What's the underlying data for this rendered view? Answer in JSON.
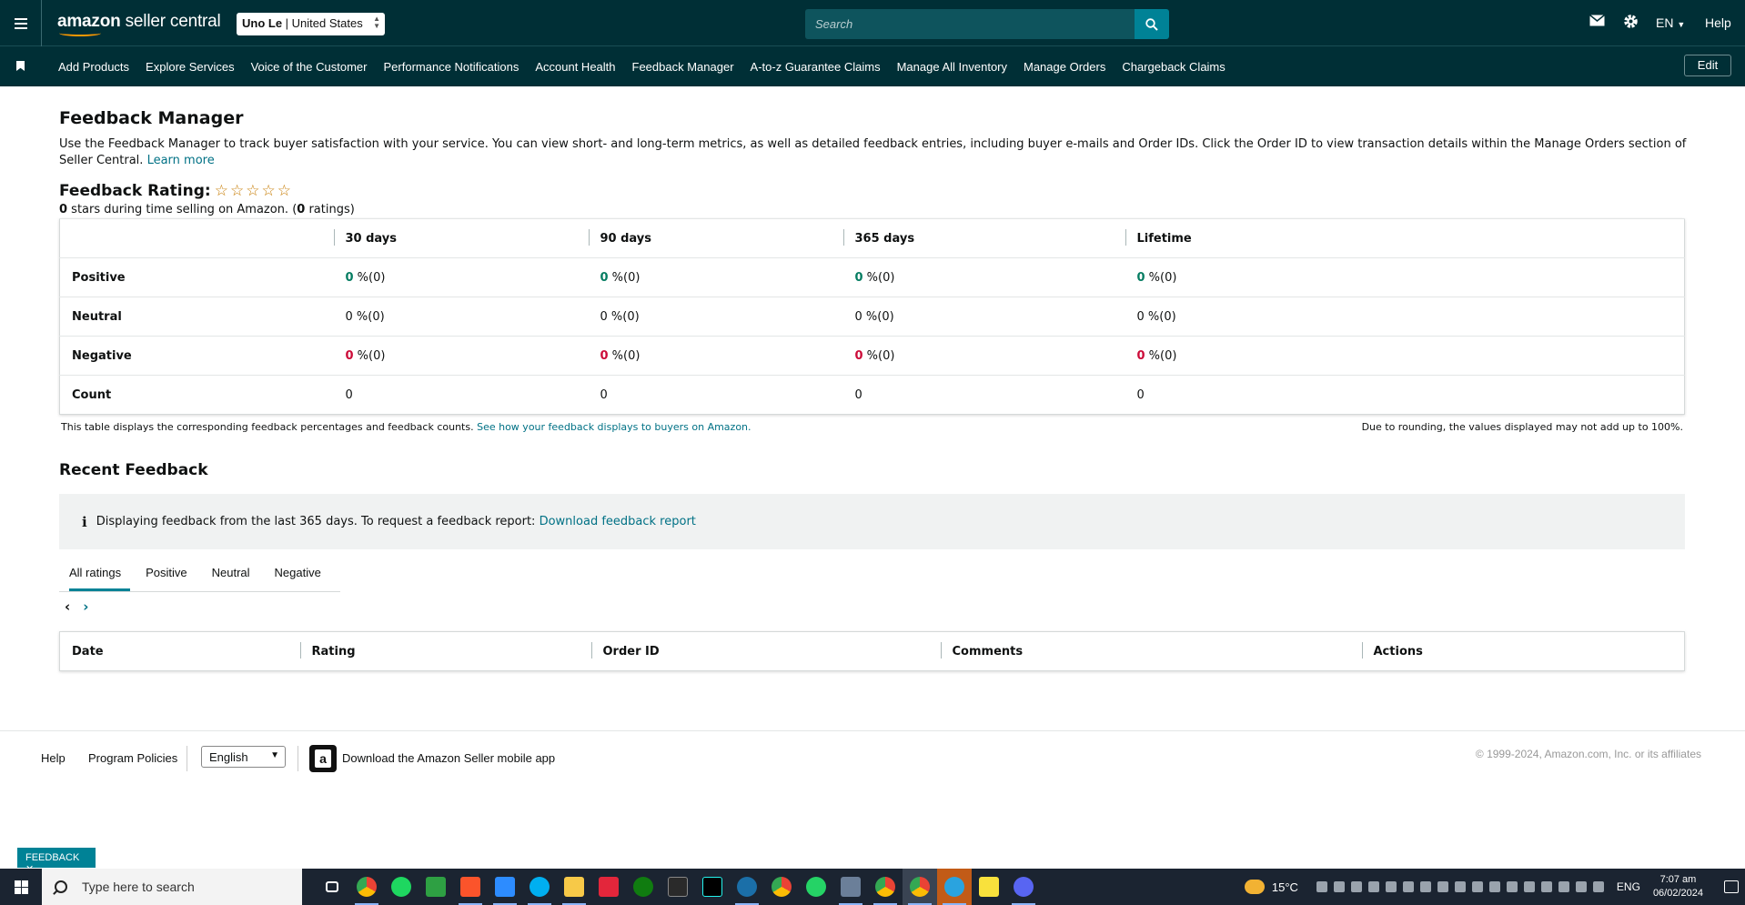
{
  "topbar": {
    "logo_bold": "amazon",
    "logo_rest": " seller central",
    "account_name": "Uno Le",
    "account_sep": " | ",
    "account_region": "United States",
    "search_placeholder": "Search",
    "language": "EN",
    "help": "Help"
  },
  "navbar": {
    "items": [
      "Add Products",
      "Explore Services",
      "Voice of the Customer",
      "Performance Notifications",
      "Account Health",
      "Feedback Manager",
      "A-to-z Guarantee Claims",
      "Manage All Inventory",
      "Manage Orders",
      "Chargeback Claims"
    ],
    "edit_label": "Edit"
  },
  "page": {
    "title": "Feedback Manager",
    "description": "Use the Feedback Manager to track buyer satisfaction with your service. You can view short- and long-term metrics, as well as detailed feedback entries, including buyer e-mails and Order IDs. Click the Order ID to view transaction details within the Manage Orders section of Seller Central.",
    "learn_more": "Learn more",
    "rating_title": "Feedback Rating:",
    "rating_stars": 0,
    "rating_value": "0",
    "rating_sub_text": " stars during time selling on Amazon. (",
    "rating_count": "0",
    "rating_sub_end": " ratings)"
  },
  "metrics": {
    "columns": [
      "",
      "30 days",
      "90 days",
      "365 days",
      "Lifetime"
    ],
    "rows": [
      {
        "label": "Positive",
        "kind": "pos",
        "cells": [
          {
            "v": "0",
            "s": " %(0)"
          },
          {
            "v": "0",
            "s": " %(0)"
          },
          {
            "v": "0",
            "s": " %(0)"
          },
          {
            "v": "0",
            "s": " %(0)"
          }
        ]
      },
      {
        "label": "Neutral",
        "kind": "neu",
        "cells": [
          {
            "v": "0",
            "s": " %(0)"
          },
          {
            "v": "0",
            "s": " %(0)"
          },
          {
            "v": "0",
            "s": " %(0)"
          },
          {
            "v": "0",
            "s": " %(0)"
          }
        ]
      },
      {
        "label": "Negative",
        "kind": "neg",
        "cells": [
          {
            "v": "0",
            "s": " %(0)"
          },
          {
            "v": "0",
            "s": " %(0)"
          },
          {
            "v": "0",
            "s": " %(0)"
          },
          {
            "v": "0",
            "s": " %(0)"
          }
        ]
      },
      {
        "label": "Count",
        "kind": "count",
        "cells": [
          {
            "v": "0",
            "s": ""
          },
          {
            "v": "0",
            "s": ""
          },
          {
            "v": "0",
            "s": ""
          },
          {
            "v": "0",
            "s": ""
          }
        ]
      }
    ],
    "note": "This table displays the corresponding feedback percentages and feedback counts.",
    "note_link": "See how your feedback displays to buyers on Amazon.",
    "note_right": "Due to rounding, the values displayed may not add up to 100%."
  },
  "recent": {
    "title": "Recent Feedback",
    "info_text": "Displaying feedback from the last 365 days. To request a feedback report:",
    "info_link": "Download feedback report",
    "tabs": [
      "All ratings",
      "Positive",
      "Neutral",
      "Negative"
    ],
    "active_tab": 0,
    "pager_prev": "‹",
    "pager_next": "›",
    "columns": [
      "Date",
      "Rating",
      "Order ID",
      "Comments",
      "Actions"
    ]
  },
  "footer": {
    "help": "Help",
    "program_policies": "Program Policies",
    "language": "English",
    "app_text": "Download the Amazon Seller mobile app",
    "copyright": "© 1999-2024, Amazon.com, Inc. or its affiliates"
  },
  "feedback_tab": "FEEDBACK ✕",
  "taskbar": {
    "search_placeholder": "Type here to search",
    "weather": "15°C",
    "lang": "ENG",
    "time": "7:07 am",
    "date": "06/02/2024"
  },
  "colors": {
    "topbar_bg": "#002f36",
    "accent": "#008296",
    "positive": "#067d62",
    "negative": "#cc0c39",
    "link": "#007185"
  }
}
